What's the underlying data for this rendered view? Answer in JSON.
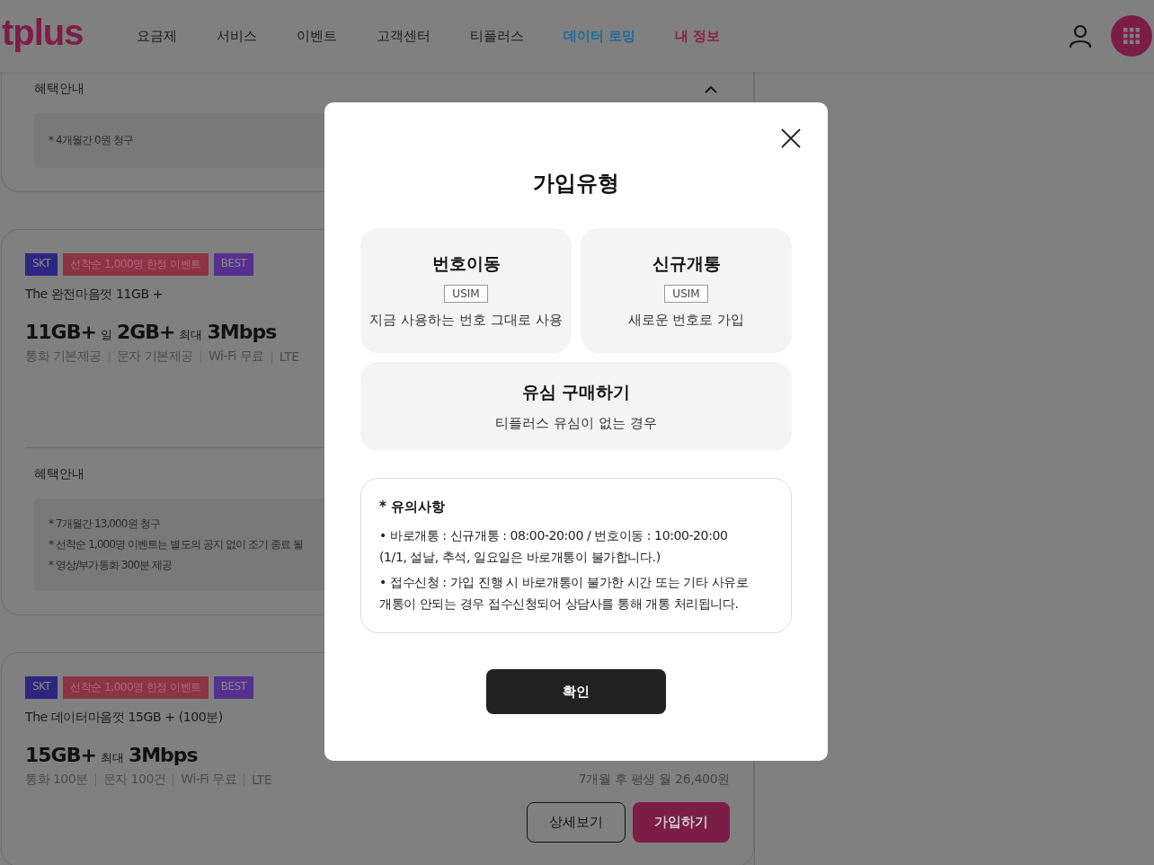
{
  "header": {
    "logo": "tplus",
    "nav": [
      {
        "label": "요금제",
        "color": "#1a1a1a"
      },
      {
        "label": "서비스",
        "color": "#1a1a1a"
      },
      {
        "label": "이벤트",
        "color": "#1a1a1a"
      },
      {
        "label": "고객센터",
        "color": "#1a1a1a"
      },
      {
        "label": "티플러스",
        "color": "#1a1a1a"
      },
      {
        "label": "데이터 로밍",
        "color": "#1c6a9c"
      },
      {
        "label": "내 정보",
        "color": "#8c1f4a"
      }
    ]
  },
  "plans": [
    {
      "benefit_title": "혜택안내",
      "benefits": [
        "* 4개월간 0원 청구"
      ]
    },
    {
      "tags": [
        {
          "label": "SKT",
          "color": "#2e2580"
        },
        {
          "label": "선착순 1,000명 한정 이벤트",
          "color": "#8c3444"
        },
        {
          "label": "BEST",
          "color": "#56308e"
        }
      ],
      "name": "The 완전마음껏 11GB +",
      "spec": [
        {
          "text": "11GB+",
          "kind": "big"
        },
        {
          "text": "일",
          "kind": "small"
        },
        {
          "text": "2GB+",
          "kind": "big"
        },
        {
          "text": "최대",
          "kind": "small"
        },
        {
          "text": "3Mbps",
          "kind": "big"
        }
      ],
      "features": [
        "통화 기본제공",
        "문자 기본제공",
        "Wi-Fi 무료",
        "LTE"
      ],
      "benefit_title": "혜택안내",
      "benefits": [
        "* 7개월간 13,000원 청구",
        "* 선착순 1,000명 이벤트는 별도의 공지 없이 조기 종료 될",
        "* 영상/부가통화 300분 제공"
      ]
    },
    {
      "tags": [
        {
          "label": "SKT",
          "color": "#2e2580"
        },
        {
          "label": "선착순 1,000명 한정 이벤트",
          "color": "#8c3444"
        },
        {
          "label": "BEST",
          "color": "#56308e"
        }
      ],
      "name": "The 데이터마음껏 15GB + (100분)",
      "spec": [
        {
          "text": "15GB+",
          "kind": "big"
        },
        {
          "text": "최대",
          "kind": "small"
        },
        {
          "text": "3Mbps",
          "kind": "big"
        }
      ],
      "features": [
        "통화 100분",
        "문자 100건",
        "Wi-Fi 무료",
        "LTE"
      ],
      "after_price": "7개월 후 평생 월 26,400원",
      "buttons": [
        {
          "label": "상세보기",
          "kind": "outline"
        },
        {
          "label": "가입하기",
          "kind": "primary"
        }
      ]
    }
  ],
  "modal": {
    "title": "가입유형",
    "options": [
      {
        "title": "번호이동",
        "tag": "USIM",
        "description": "지금 사용하는 번호 그대로 사용"
      },
      {
        "title": "신규개통",
        "tag": "USIM",
        "description": "새로운 번호로 가입"
      },
      {
        "title": "유심 구매하기",
        "description": "티플러스 유심이 없는 경우"
      }
    ],
    "notice": {
      "title": "* 유의사항",
      "items": [
        "• 바로개통 : 신규개통 : 08:00-20:00 / 번호이동 : 10:00-20:00\n(1/1, 설날, 추석, 일요일은 바로개통이 불가합니다.)",
        "• 접수신청 : 가입 진행 시 바로개통이 불가한 시간 또는 기타 사유로\n개통이 안되는 경우 접수신청되어 상담사를 통해 개통 처리됩니다."
      ]
    },
    "confirm": "확인"
  }
}
